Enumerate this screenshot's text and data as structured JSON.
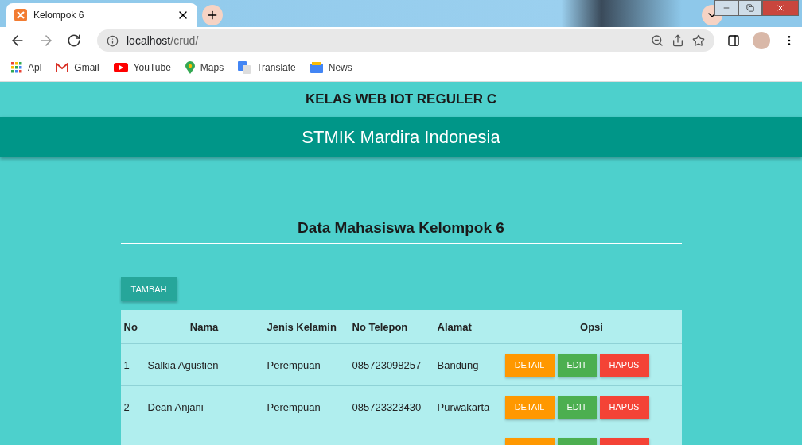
{
  "browser": {
    "tab_title": "Kelompok 6",
    "url_host": "localhost",
    "url_path": "/crud/",
    "bookmarks": [
      {
        "label": "Apl",
        "kind": "apps"
      },
      {
        "label": "Gmail",
        "kind": "gmail"
      },
      {
        "label": "YouTube",
        "kind": "youtube"
      },
      {
        "label": "Maps",
        "kind": "maps"
      },
      {
        "label": "Translate",
        "kind": "translate"
      },
      {
        "label": "News",
        "kind": "news"
      }
    ]
  },
  "header": {
    "subtitle": "KELAS WEB IOT REGULER C",
    "title": "STMIK Mardira Indonesia"
  },
  "content": {
    "heading": "Data Mahasiswa Kelompok 6",
    "add_button": "TAMBAH",
    "table": {
      "columns": [
        "No",
        "Nama",
        "Jenis Kelamin",
        "No Telepon",
        "Alamat",
        "Opsi"
      ],
      "rows": [
        {
          "cells": [
            "1",
            "Salkia Agustien",
            "Perempuan",
            "085723098257",
            "Bandung"
          ],
          "actions": [
            {
              "label": "DETAIL",
              "kind": "detail"
            },
            {
              "label": "EDIT",
              "kind": "edit"
            },
            {
              "label": "HAPUS",
              "kind": "delete"
            }
          ]
        },
        {
          "cells": [
            "2",
            "Dean Anjani",
            "Perempuan",
            "085723323430",
            "Purwakarta"
          ],
          "actions": [
            {
              "label": "DETAIL",
              "kind": "detail"
            },
            {
              "label": "EDIT",
              "kind": "edit"
            },
            {
              "label": "HAPUS",
              "kind": "delete"
            }
          ]
        },
        {
          "cells": [],
          "actions": [
            {
              "kind": "detail"
            },
            {
              "kind": "edit"
            },
            {
              "kind": "delete"
            }
          ]
        }
      ]
    }
  }
}
